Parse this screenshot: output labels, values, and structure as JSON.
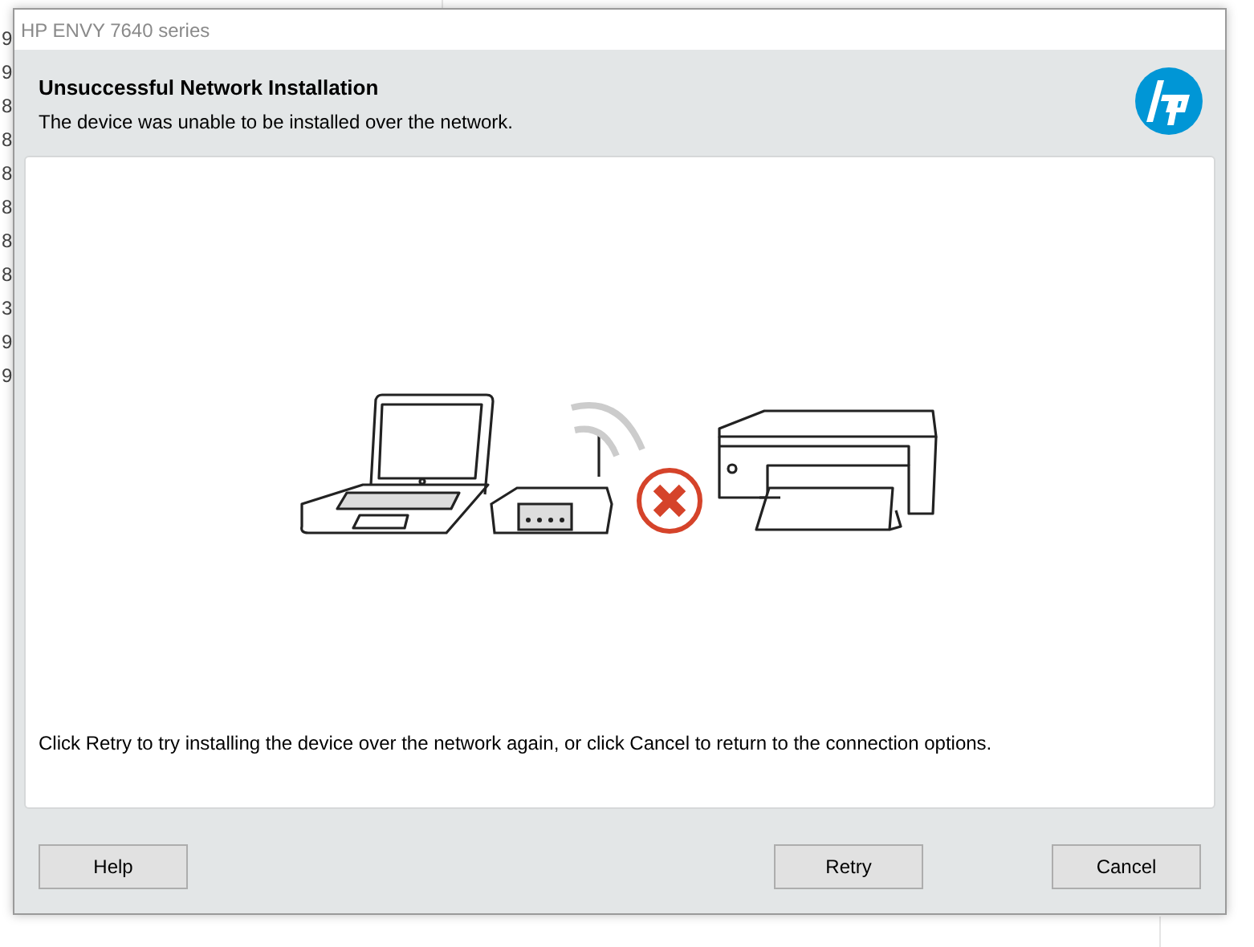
{
  "background_list": {
    "edge_texts": [
      "9",
      "9",
      "8",
      "8",
      "8",
      "8",
      "8",
      "8",
      "3",
      "9",
      "9"
    ]
  },
  "window": {
    "title": "HP ENVY 7640 series"
  },
  "header": {
    "title": "Unsuccessful Network Installation",
    "subtitle": "The device was unable to be installed over the network."
  },
  "message": "Click Retry to try installing the device over the network again, or click Cancel to return to the connection options.",
  "buttons": [
    {
      "label": "Help",
      "kind": "left"
    },
    {
      "label": "Retry",
      "kind": "right"
    },
    {
      "label": "Cancel",
      "kind": "right"
    }
  ]
}
